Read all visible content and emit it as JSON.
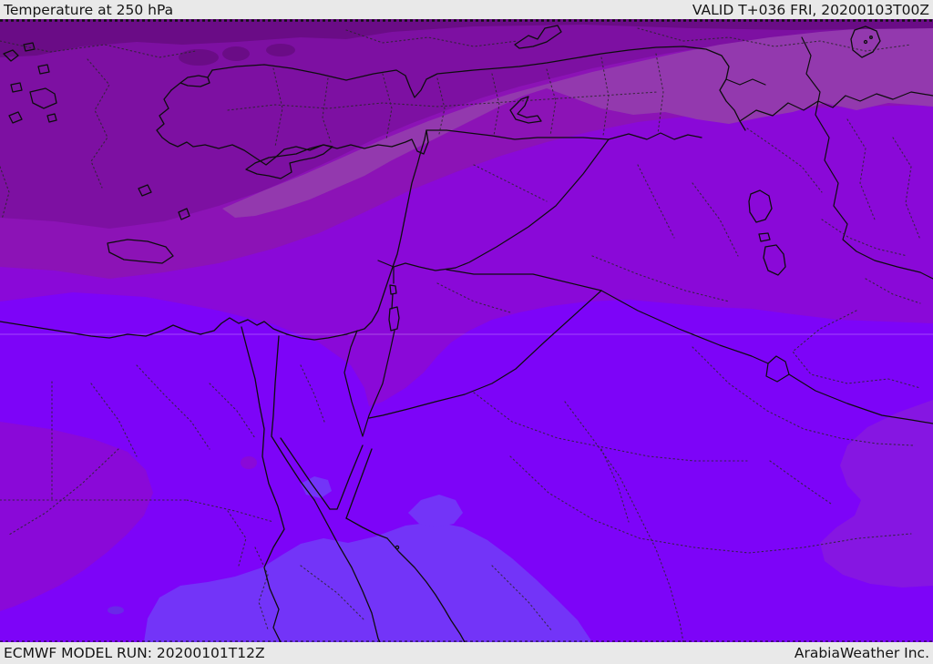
{
  "header": {
    "title": "Temperature at 250 hPa",
    "valid_label": "VALID T+036 FRI, 20200103T00Z"
  },
  "footer": {
    "model_run": "ECMWF MODEL RUN: 20200101T12Z",
    "provider": "ArabiaWeather Inc."
  },
  "map": {
    "type": "filled-contour temperature field with political boundaries",
    "region": "Middle East / Eastern Mediterranean",
    "bar_background": "#e9e9e9",
    "bar_text_color": "#151515",
    "temperature_band_colors_north_to_south": {
      "coldest_top_strip": "#6a0c86",
      "dark_purple": "#7d10a2",
      "medium_purple": "#8c13b6",
      "gray_lavender_band": "#9339ae",
      "violet": "#8a09d8",
      "violet_southeast": "#8616e2",
      "bright_violet_base": "#7d04f8",
      "blue_violet_patches": "#7334f8",
      "blue_spot": "#6a28e8"
    },
    "boundary_line_color": "#0d0d0d",
    "gridline_color": "rgba(255,255,255,0.28)"
  }
}
